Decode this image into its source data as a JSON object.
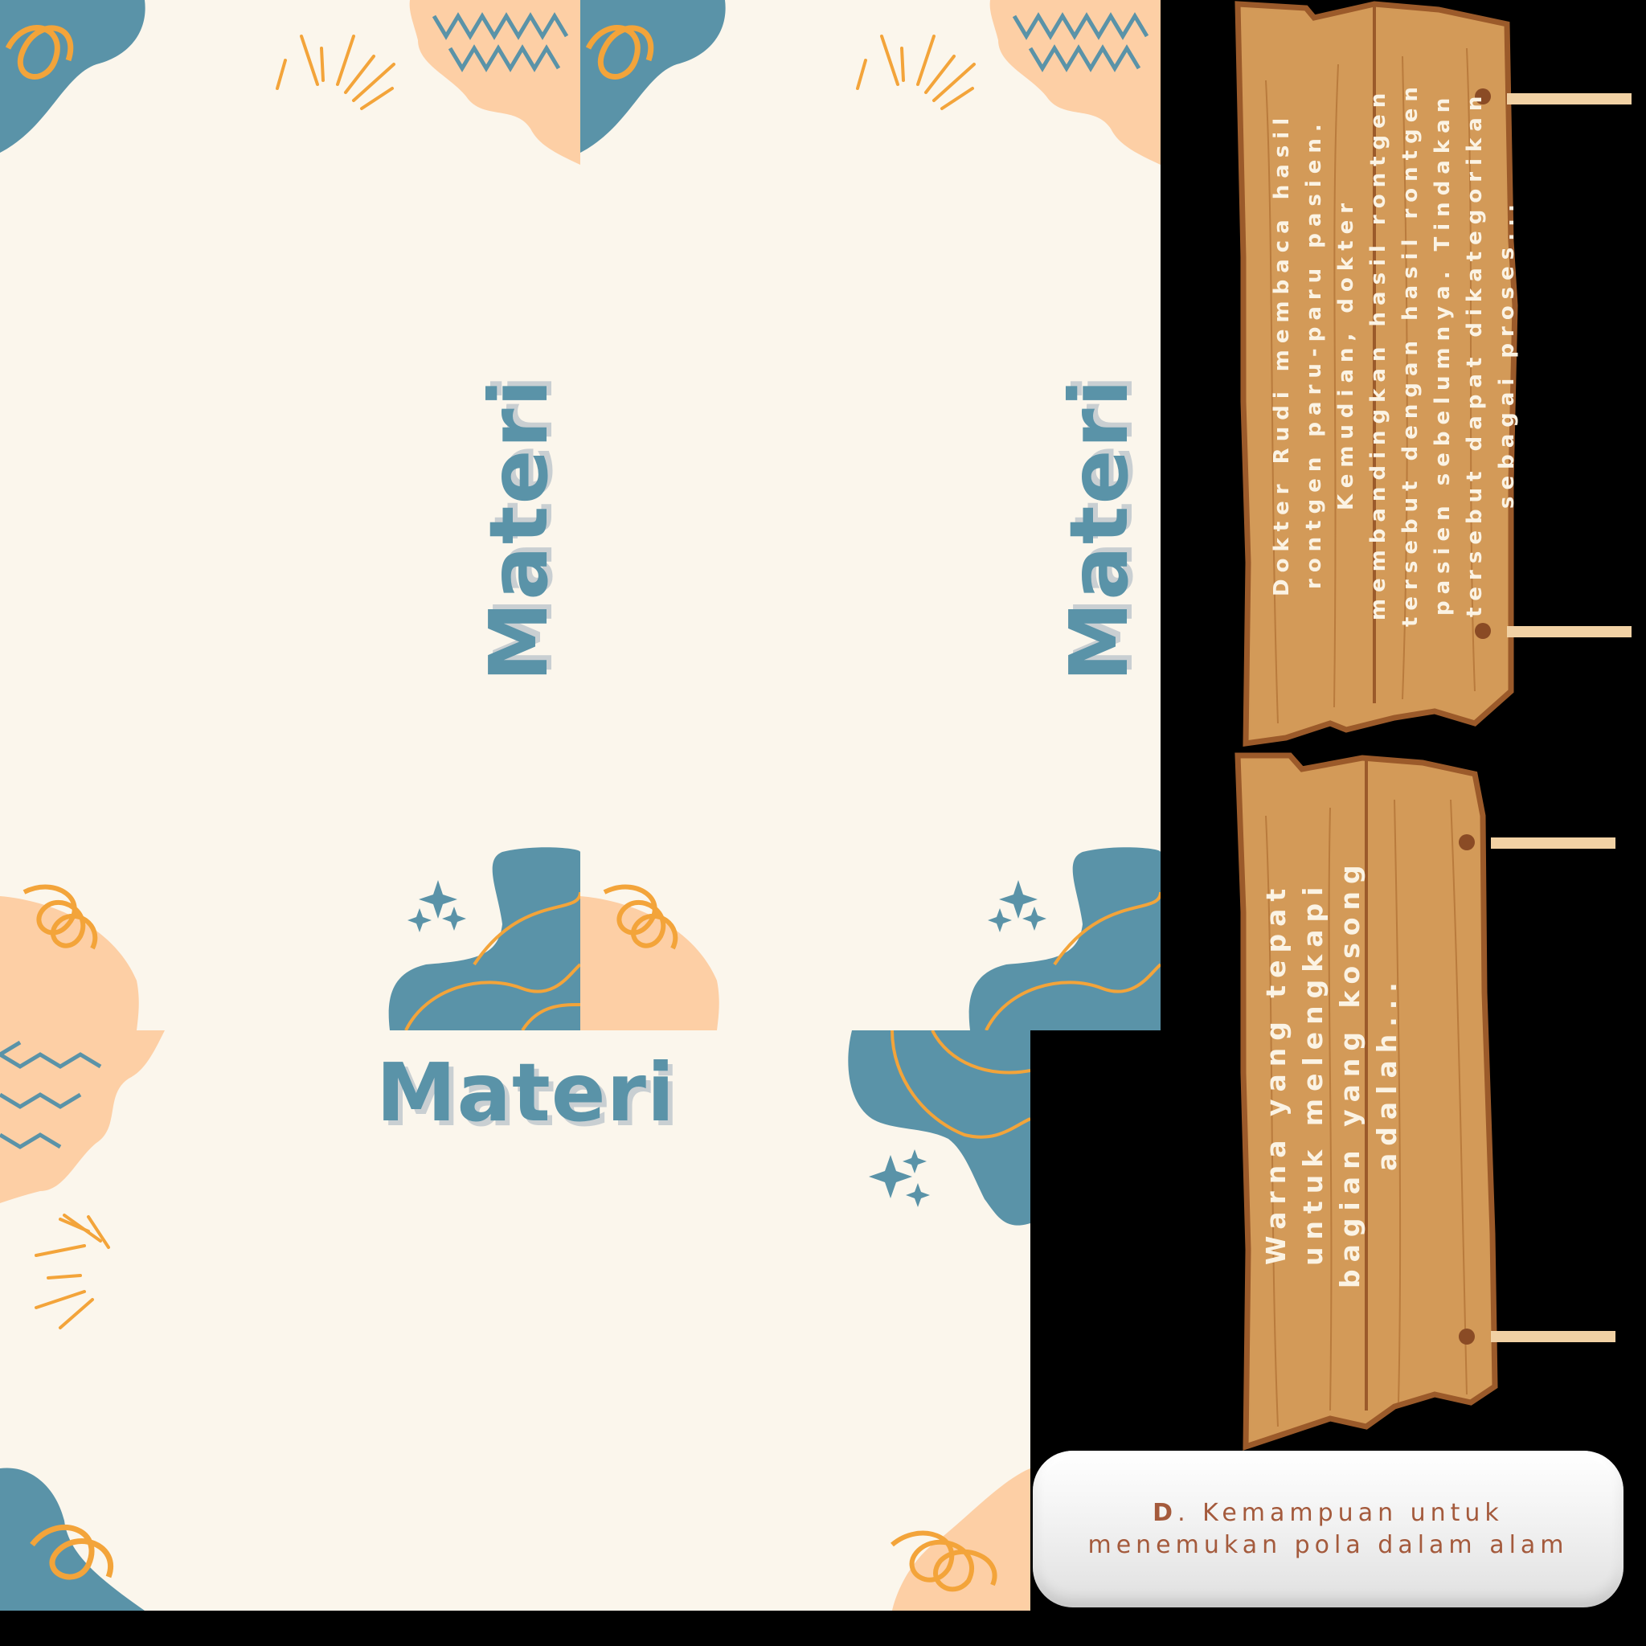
{
  "slides": {
    "vertical_titles": [
      "Materi",
      "Materi"
    ],
    "horizontal_title": "Materi"
  },
  "boards": {
    "board1": {
      "text": "Dokter Rudi membaca hasil rontgen paru-paru pasien. Kemudian, dokter membandingkan hasil rontgen tersebut dengan hasil rontgen pasien sebelumnya. Tindakan tersebut dapat dikategorikan sebagai proses..."
    },
    "board2": {
      "text": "Warna yang tepat untuk melengkapi bagian yang kosong adalah..."
    }
  },
  "answer": {
    "letter": "D",
    "separator": ".",
    "text": "Kemampuan untuk menemukan pola dalam alam"
  },
  "colors": {
    "background": "#000000",
    "panel": "#fbf6ec",
    "blue": "#5a93a8",
    "peach": "#fdcfa5",
    "orange": "#f3a43a",
    "wood": "#d39a58",
    "wood_dark": "#9b5a2a",
    "answer_text": "#a45a3c"
  }
}
